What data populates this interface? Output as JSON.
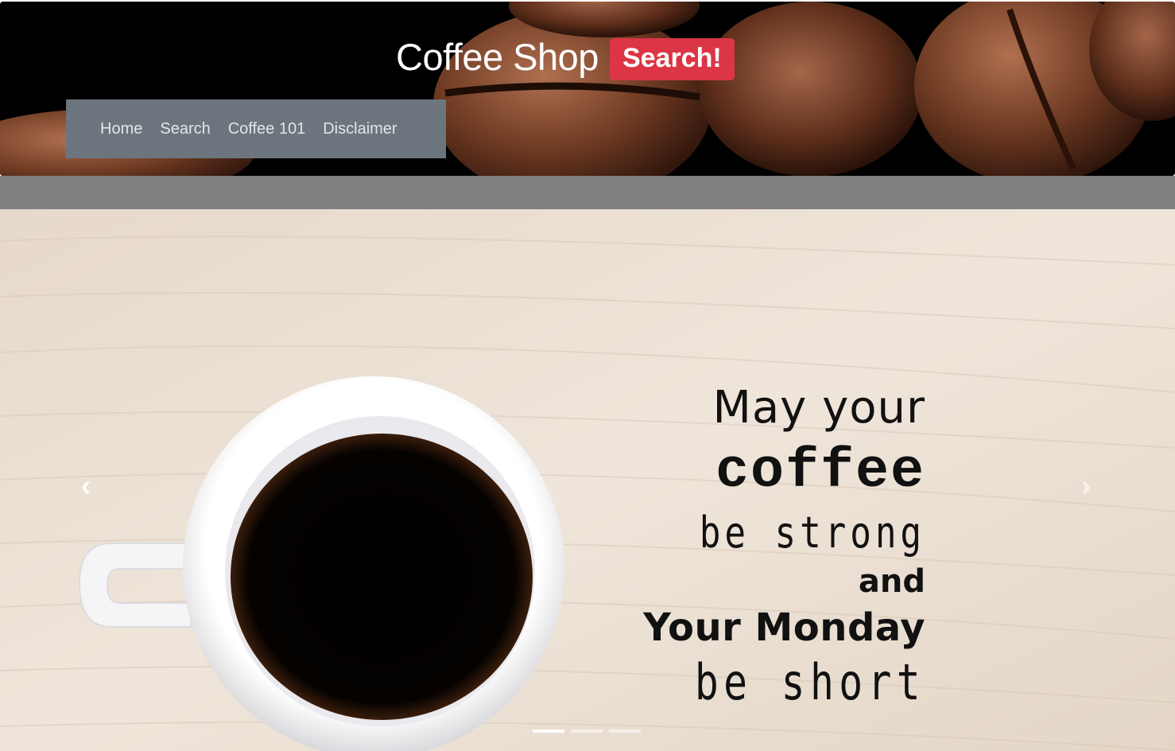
{
  "header": {
    "brand": "Coffee Shop",
    "badge": "Search!",
    "nav": [
      "Home",
      "Search",
      "Coffee 101",
      "Disclaimer"
    ]
  },
  "carousel": {
    "quote": [
      "May your",
      "coffee",
      "be strong",
      "and",
      "Your Monday",
      "be short"
    ],
    "controls": {
      "prev": "‹",
      "next": "›"
    },
    "indicators": {
      "count": 3,
      "active": 0
    }
  },
  "colors": {
    "badge": "#dc3545",
    "nav_bg": "#6c757d",
    "band": "#7f7f7f"
  }
}
